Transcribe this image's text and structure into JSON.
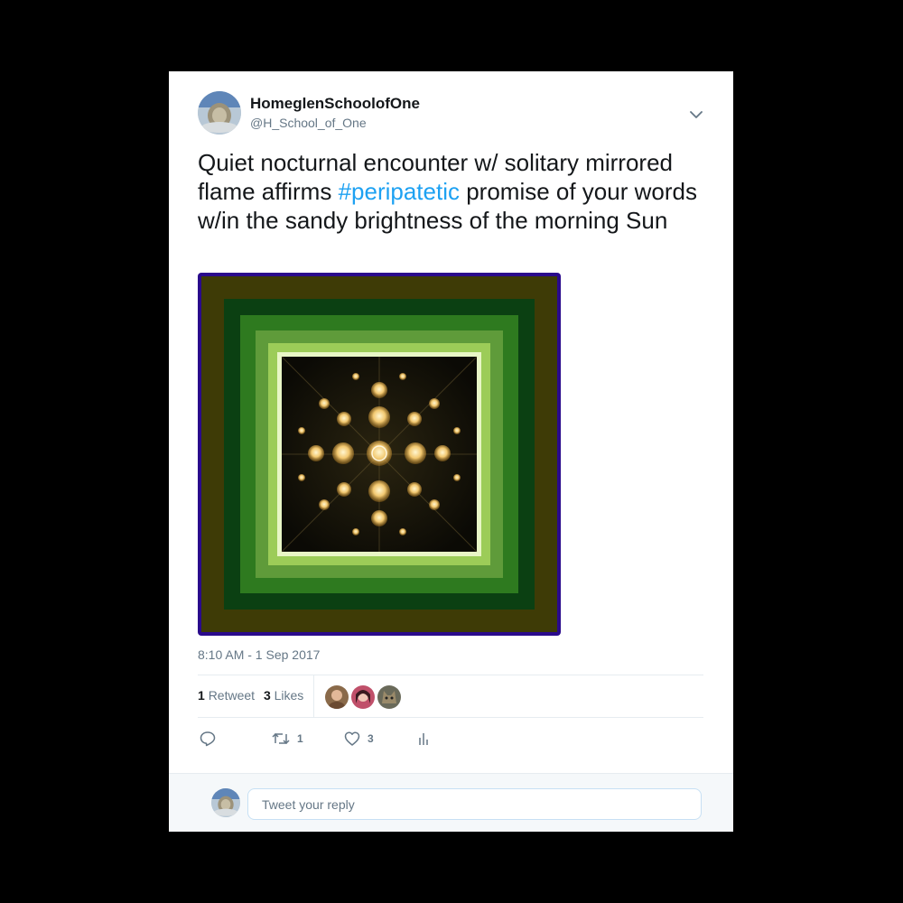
{
  "author": {
    "display_name": "HomeglenSchoolofOne",
    "handle": "@H_School_of_One"
  },
  "tweet": {
    "text_before": "Quiet nocturnal encounter w/ solitary mirrored flame affirms ",
    "hashtag": "#peripatetic",
    "text_after": " promise of your words w/in the sandy brightness of the morning Sun",
    "timestamp": "8:10 AM - 1 Sep 2017"
  },
  "stats": {
    "retweets_count": "1",
    "retweets_label": "Retweet",
    "likes_count": "3",
    "likes_label": "Likes"
  },
  "actions": {
    "reply_icon": "reply-icon",
    "retweet_icon": "retweet-icon",
    "retweet_count": "1",
    "like_icon": "heart-icon",
    "like_count": "3",
    "analytics_icon": "analytics-icon"
  },
  "reply": {
    "placeholder": "Tweet your reply"
  },
  "colors": {
    "link": "#1da1f2",
    "muted": "#657786",
    "text": "#14171a",
    "frame_border": "#2a0a8c"
  }
}
